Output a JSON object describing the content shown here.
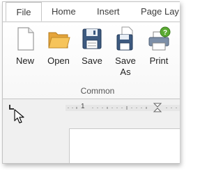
{
  "tabs": [
    {
      "label": "File",
      "active": true
    },
    {
      "label": "Home",
      "active": false
    },
    {
      "label": "Insert",
      "active": false
    },
    {
      "label": "Page Lay",
      "active": false
    }
  ],
  "ribbon": {
    "buttons": [
      {
        "label": "New",
        "icon": "new-document-icon"
      },
      {
        "label": "Open",
        "icon": "open-folder-icon"
      },
      {
        "label": "Save",
        "icon": "floppy-disk-icon"
      },
      {
        "label": "Save As",
        "label_line1": "Save",
        "label_line2": "As",
        "icon": "save-as-icon"
      },
      {
        "label": "Print",
        "icon": "printer-help-icon"
      }
    ],
    "group_label": "Common"
  },
  "ruler": {
    "number": "1",
    "tab_selector_icon": "left-tab-stop-icon",
    "indent_marker_icon": "indent-marker-icon"
  },
  "cursor_icon": "mouse-pointer-icon",
  "colors": {
    "accent_border": "#c5c5c5",
    "ruler_background": "#f0f0f0",
    "folder": "#f2b84b",
    "disk": "#3d5a80",
    "help": "#5aaa32"
  }
}
